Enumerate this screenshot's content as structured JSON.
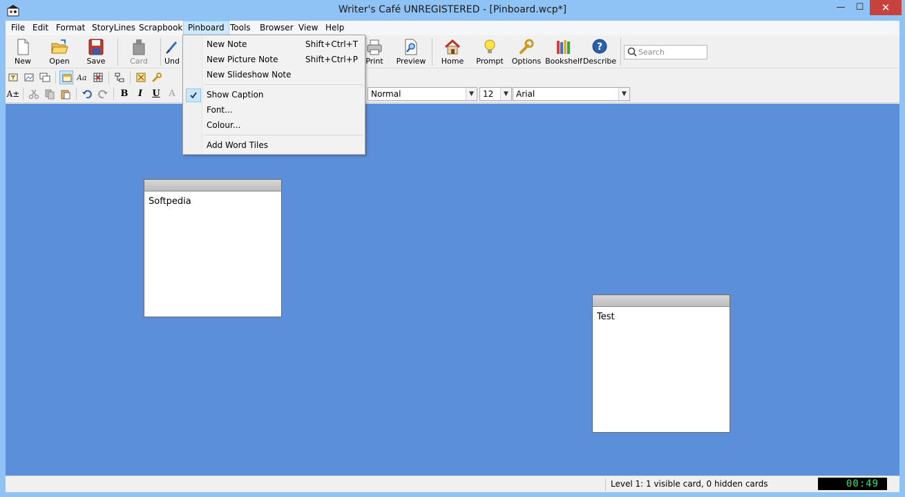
{
  "window": {
    "title": "Writer's Café - UNREGISTERED - [Pinboard.wcp*]",
    "title_display": "Writer's Café   UNREGISTERED - [Pinboard.wcp*]",
    "minimize": "—",
    "maximize": "☐",
    "close": "✕"
  },
  "menubar": {
    "items": [
      {
        "label": "File"
      },
      {
        "label": "Edit"
      },
      {
        "label": "Format"
      },
      {
        "label": "StoryLines"
      },
      {
        "label": "Scrapbook"
      },
      {
        "label": "Pinboard"
      },
      {
        "label": "Tools"
      },
      {
        "label": "Browser"
      },
      {
        "label": "View"
      },
      {
        "label": "Help"
      }
    ],
    "active": "Pinboard"
  },
  "toolbar": {
    "new": "New",
    "open": "Open",
    "save": "Save",
    "card": "Card",
    "undo": "Und",
    "print": "Print",
    "preview": "Preview",
    "home": "Home",
    "prompt": "Prompt",
    "options": "Options",
    "bookshelf": "Bookshelf",
    "describe": "Describe",
    "search_placeholder": "Search"
  },
  "format_toolbar": {
    "font_size_icon": "A±",
    "bold": "B",
    "italic": "I",
    "underline": "U",
    "font_color": "A",
    "style_value": "Normal",
    "size_value": "12",
    "font_value": "Arial"
  },
  "pinboard_menu": {
    "items": [
      {
        "label": "New Note",
        "shortcut": "Shift+Ctrl+T"
      },
      {
        "label": "New Picture Note",
        "shortcut": "Shift+Ctrl+P"
      },
      {
        "label": "New Slideshow Note",
        "shortcut": ""
      },
      {
        "label": "Show Caption",
        "shortcut": "",
        "checked": true
      },
      {
        "label": "Font...",
        "shortcut": ""
      },
      {
        "label": "Colour...",
        "shortcut": ""
      },
      {
        "label": "Add Word Tiles",
        "shortcut": ""
      }
    ]
  },
  "cards": [
    {
      "text": "Softpedia"
    },
    {
      "text": "Test"
    }
  ],
  "statusbar": {
    "text": "Level 1: 1 visible card, 0 hidden cards",
    "clock": "00:49"
  },
  "colors": {
    "pinboard_background": "#5b8fd9",
    "titlebar": "#8fc3f5",
    "close_button": "#c7423b",
    "menu_highlight": "#cce8ff"
  }
}
